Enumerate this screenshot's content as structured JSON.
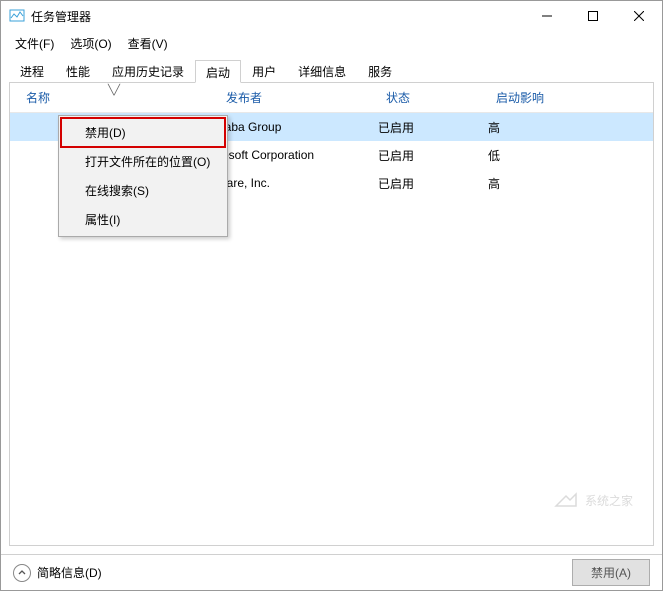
{
  "window": {
    "title": "任务管理器"
  },
  "menubar": {
    "file": "文件(F)",
    "options": "选项(O)",
    "view": "查看(V)"
  },
  "tabs": {
    "processes": "进程",
    "performance": "性能",
    "history": "应用历史记录",
    "startup": "启动",
    "users": "用户",
    "details": "详细信息",
    "services": "服务"
  },
  "columns": {
    "name": "名称",
    "publisher": "发布者",
    "status": "状态",
    "impact": "启动影响"
  },
  "rows": [
    {
      "name": "",
      "publisher": "baba Group",
      "status": "已启用",
      "impact": "高"
    },
    {
      "name": "",
      "publisher": "rosoft Corporation",
      "status": "已启用",
      "impact": "低"
    },
    {
      "name": "",
      "publisher": "ware, Inc.",
      "status": "已启用",
      "impact": "高"
    }
  ],
  "context_menu": {
    "disable": "禁用(D)",
    "open_location": "打开文件所在的位置(O)",
    "search_online": "在线搜索(S)",
    "properties": "属性(I)"
  },
  "statusbar": {
    "fewer": "简略信息(D)",
    "disable_btn": "禁用(A)"
  },
  "watermark": "系统之家"
}
